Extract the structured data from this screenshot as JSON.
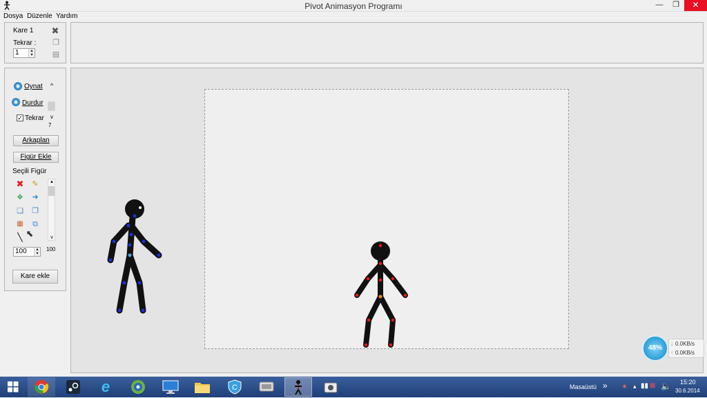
{
  "window": {
    "title": "Pivot Animasyon Programı",
    "minimize": "—",
    "maximize": "❐",
    "close": "✕"
  },
  "menu": {
    "items": [
      "Dosya",
      "Düzenle",
      "Yardım"
    ]
  },
  "frame_panel": {
    "frame_label": "Kare 1",
    "repeat_label": "Tekrar :",
    "repeat_value": "1"
  },
  "tools": {
    "play_label": "Oynat",
    "stop_label": "Durdur",
    "loop_label": "Tekrar",
    "loop_checked": true,
    "speed_value": "7",
    "background_button": "Arkaplan",
    "add_figure_button": "Figür Ekle",
    "selected_figure_label": "Seçili Figür",
    "size_value": "100",
    "size_scroll_value": "100",
    "add_frame_button": "Kare ekle"
  },
  "taskbar": {
    "apps": [
      "start",
      "chrome",
      "steam",
      "internet-explorer",
      "android-studio",
      "remote-desktop",
      "file-explorer",
      "security-c",
      "monitor",
      "pivot",
      "camera"
    ],
    "active_app": "pivot",
    "desktop_label": "Masaüstü",
    "time": "15:20",
    "date": "30.6.2014"
  },
  "net_widget": {
    "percent": "48%",
    "down": "0.0KB/s",
    "up": "0.0KB/s"
  },
  "colors": {
    "accent": "#2a7fc0",
    "figure": "#111111",
    "blue_joint": "#1e2fd6",
    "red_joint": "#e01c1c",
    "orange_joint": "#e98a1c",
    "close_red": "#e81123"
  }
}
